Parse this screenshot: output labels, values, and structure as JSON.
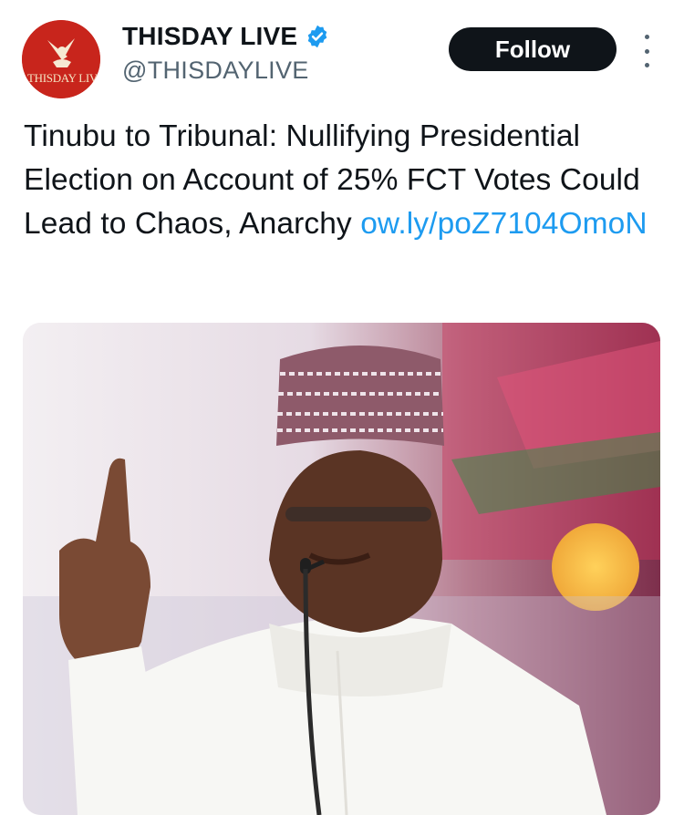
{
  "account": {
    "name": "THISDAY LIVE",
    "handle": "@THISDAYLIVE",
    "avatar_text": "THISDAY LIVE",
    "verified_icon": "verified-badge-icon",
    "brand_color": "#c8251c"
  },
  "actions": {
    "follow_label": "Follow",
    "more_icon": "more-vertical-icon"
  },
  "tweet": {
    "text": "Tinubu to Tribunal: Nullifying Presidential Election on Account of 25% FCT Votes Could Lead to Chaos, Anarchy",
    "link": "ow.ly/poZ7104OmoN",
    "link_color": "#1d9bf0"
  },
  "media": {
    "type": "photo"
  }
}
